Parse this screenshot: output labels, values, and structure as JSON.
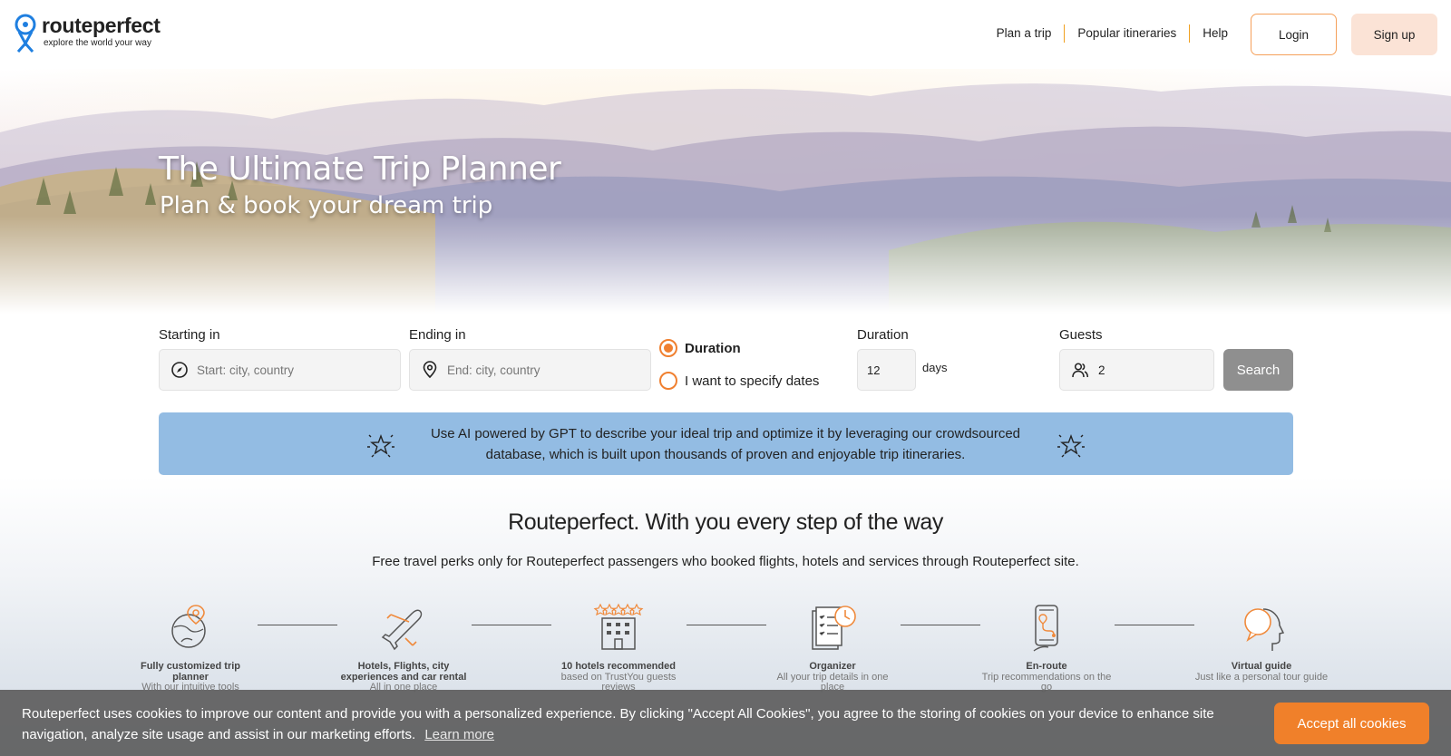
{
  "header": {
    "logo_name": "routeperfect",
    "logo_tagline": "explore the world your way",
    "nav": [
      "Plan a trip",
      "Popular itineraries",
      "Help"
    ],
    "login_label": "Login",
    "signup_label": "Sign up"
  },
  "hero": {
    "title": "The Ultimate Trip Planner",
    "subtitle": "Plan & book your dream trip"
  },
  "search": {
    "start_label": "Starting in",
    "start_placeholder": "Start: city, country",
    "end_label": "Ending in",
    "end_placeholder": "End: city, country",
    "radio_duration": "Duration",
    "radio_dates": "I want to specify dates",
    "duration_label": "Duration",
    "duration_value": "12",
    "duration_unit": "days",
    "guests_label": "Guests",
    "guests_value": "2",
    "search_label": "Search"
  },
  "ai_banner": {
    "text": "Use AI powered by GPT to describe your ideal trip and optimize it by leveraging our crowdsourced database, which is built upon thousands of proven and enjoyable trip itineraries."
  },
  "perks": {
    "title": "Routeperfect. With you every step of the way",
    "subtitle": "Free travel perks only for Routeperfect passengers who booked flights, hotels and services through Routeperfect site.",
    "items": [
      {
        "name": "Fully customized trip planner",
        "desc": "With our intuitive tools",
        "icon": "globe-pin-icon"
      },
      {
        "name": "Hotels, Flights, city experiences and car rental",
        "desc": "All in one place",
        "icon": "airplane-icon"
      },
      {
        "name": "10 hotels recommended",
        "desc": "based on TrustYou guests reviews",
        "icon": "hotel-stars-icon"
      },
      {
        "name": "Organizer",
        "desc": "All your trip details in one place",
        "icon": "organizer-clock-icon"
      },
      {
        "name": "En-route",
        "desc": "Trip recommendations on the go",
        "icon": "phone-route-icon"
      },
      {
        "name": "Virtual guide",
        "desc": "Just like a personal tour guide",
        "icon": "head-bubble-icon"
      }
    ]
  },
  "cookie": {
    "text": "Routeperfect uses cookies to improve our content and provide you with a personalized experience. By clicking \"Accept All Cookies\", you agree to the storing of cookies on your device to enhance site navigation, analyze site usage and assist in our marketing efforts.",
    "learn_more": "Learn more",
    "accept_label": "Accept all cookies"
  },
  "colors": {
    "accent": "#f0802a",
    "ai_banner": "#93bce3",
    "search_button": "#8f8f8f",
    "logo_blue": "#1f7fe0"
  }
}
